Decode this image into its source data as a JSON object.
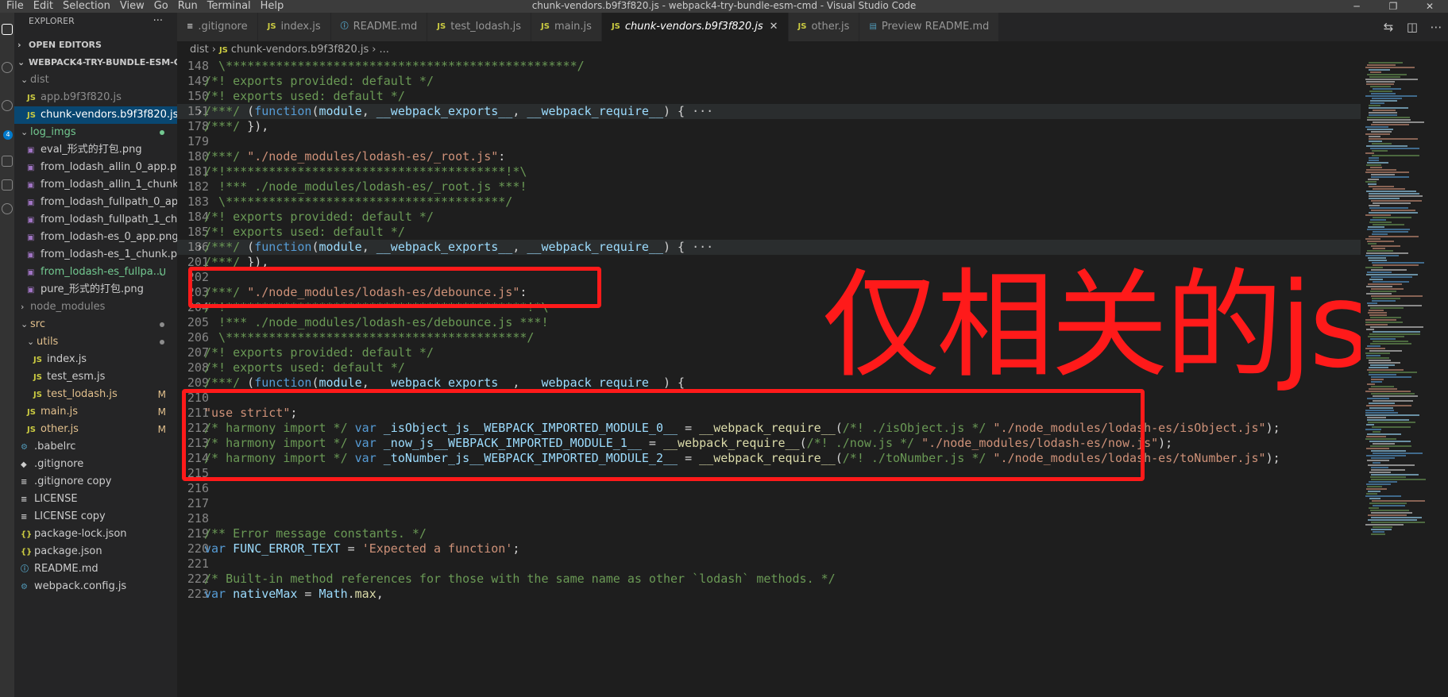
{
  "window": {
    "title": "chunk-vendors.b9f3f820.js - webpack4-try-bundle-esm-cmd - Visual Studio Code",
    "menus": [
      "File",
      "Edit",
      "Selection",
      "View",
      "Go",
      "Run",
      "Terminal",
      "Help"
    ]
  },
  "activity_bar": {
    "badge": "4"
  },
  "sidebar": {
    "title": "EXPLORER",
    "more": "···",
    "open_editors": "OPEN EDITORS",
    "project": "WEBPACK4-TRY-BUNDLE-ESM-C...",
    "items": [
      {
        "label": "dist",
        "type": "folder",
        "open": true,
        "indent": 1,
        "color": "#8c8c8c"
      },
      {
        "label": "app.b9f3f820.js",
        "type": "js",
        "indent": 2,
        "color": "#8c8c8c"
      },
      {
        "label": "chunk-vendors.b9f3f820.js",
        "type": "js",
        "indent": 2,
        "selected": true,
        "color": "#ffffff"
      },
      {
        "label": "log_imgs",
        "type": "folder",
        "open": true,
        "indent": 1,
        "color": "#73c991",
        "dot": "#73c991"
      },
      {
        "label": "eval_形式的打包.png",
        "type": "img",
        "indent": 2,
        "color": "#cccccc"
      },
      {
        "label": "from_lodash_allin_0_app.png",
        "type": "img",
        "indent": 2,
        "color": "#cccccc"
      },
      {
        "label": "from_lodash_allin_1_chunk....",
        "type": "img",
        "indent": 2,
        "color": "#cccccc"
      },
      {
        "label": "from_lodash_fullpath_0_ap...",
        "type": "img",
        "indent": 2,
        "color": "#cccccc"
      },
      {
        "label": "from_lodash_fullpath_1_ch...",
        "type": "img",
        "indent": 2,
        "color": "#cccccc"
      },
      {
        "label": "from_lodash-es_0_app.png",
        "type": "img",
        "indent": 2,
        "color": "#cccccc"
      },
      {
        "label": "from_lodash-es_1_chunk.p...",
        "type": "img",
        "indent": 2,
        "color": "#cccccc"
      },
      {
        "label": "from_lodash-es_fullpa...",
        "type": "img",
        "indent": 2,
        "color": "#73c991",
        "badge": "U"
      },
      {
        "label": "pure_形式的打包.png",
        "type": "img",
        "indent": 2,
        "color": "#cccccc"
      },
      {
        "label": "node_modules",
        "type": "folder",
        "open": false,
        "indent": 1,
        "color": "#8c8c8c"
      },
      {
        "label": "src",
        "type": "folder",
        "open": true,
        "indent": 1,
        "color": "#e2c08d",
        "dot": "#8c8c8c"
      },
      {
        "label": "utils",
        "type": "folder",
        "open": true,
        "indent": 2,
        "color": "#e2c08d",
        "dot": "#8c8c8c"
      },
      {
        "label": "index.js",
        "type": "js",
        "indent": 3,
        "color": "#cccccc"
      },
      {
        "label": "test_esm.js",
        "type": "js",
        "indent": 3,
        "color": "#cccccc"
      },
      {
        "label": "test_lodash.js",
        "type": "js",
        "indent": 3,
        "color": "#e2c08d",
        "badge": "M"
      },
      {
        "label": "main.js",
        "type": "js",
        "indent": 2,
        "color": "#e2c08d",
        "badge": "M"
      },
      {
        "label": "other.js",
        "type": "js",
        "indent": 2,
        "color": "#e2c08d",
        "badge": "M"
      },
      {
        "label": ".babelrc",
        "type": "cfg",
        "indent": 1,
        "color": "#cccccc"
      },
      {
        "label": ".gitignore",
        "type": "git",
        "indent": 1,
        "color": "#cccccc"
      },
      {
        "label": ".gitignore copy",
        "type": "txt",
        "indent": 1,
        "color": "#cccccc"
      },
      {
        "label": "LICENSE",
        "type": "txt",
        "indent": 1,
        "color": "#cccccc"
      },
      {
        "label": "LICENSE copy",
        "type": "txt",
        "indent": 1,
        "color": "#cccccc"
      },
      {
        "label": "package-lock.json",
        "type": "json",
        "indent": 1,
        "color": "#cccccc"
      },
      {
        "label": "package.json",
        "type": "json",
        "indent": 1,
        "color": "#cccccc"
      },
      {
        "label": "README.md",
        "type": "md",
        "indent": 1,
        "color": "#cccccc"
      },
      {
        "label": "webpack.config.js",
        "type": "cfg",
        "indent": 1,
        "color": "#cccccc"
      }
    ]
  },
  "tabs": [
    {
      "label": ".gitignore",
      "icon": "≡",
      "type": "git"
    },
    {
      "label": "index.js",
      "icon": "JS",
      "type": "js"
    },
    {
      "label": "README.md",
      "icon": "ⓘ",
      "type": "md"
    },
    {
      "label": "test_lodash.js",
      "icon": "JS",
      "type": "js"
    },
    {
      "label": "main.js",
      "icon": "JS",
      "type": "js"
    },
    {
      "label": "chunk-vendors.b9f3f820.js",
      "icon": "JS",
      "type": "js",
      "active": true
    },
    {
      "label": "other.js",
      "icon": "JS",
      "type": "js"
    },
    {
      "label": "Preview README.md",
      "icon": "▤",
      "type": "md"
    }
  ],
  "breadcrumb": {
    "dir": "dist",
    "file": "chunk-vendors.b9f3f820.js",
    "more": "..."
  },
  "code_lines": [
    {
      "n": "148",
      "t": [
        [
          "c-com",
          "  \\*************************************************/"
        ]
      ]
    },
    {
      "n": "149",
      "t": [
        [
          "c-com",
          "/*! exports provided: default */"
        ]
      ]
    },
    {
      "n": "150",
      "t": [
        [
          "c-com",
          "/*! exports used: default */"
        ]
      ]
    },
    {
      "n": "151",
      "fold": true,
      "hl": true,
      "t": [
        [
          "c-com",
          "/***/"
        ],
        [
          "c-txt",
          " ("
        ],
        [
          "c-kw",
          "function"
        ],
        [
          "c-txt",
          "("
        ],
        [
          "c-var",
          "module"
        ],
        [
          "c-txt",
          ", "
        ],
        [
          "c-var",
          "__webpack_exports__"
        ],
        [
          "c-txt",
          ", "
        ],
        [
          "c-var",
          "__webpack_require__"
        ],
        [
          "c-txt",
          ") { "
        ],
        [
          "c-ell",
          "···"
        ]
      ]
    },
    {
      "n": "178",
      "t": [
        [
          "c-com",
          "/***/"
        ],
        [
          "c-txt",
          " }),"
        ]
      ]
    },
    {
      "n": "179",
      "t": []
    },
    {
      "n": "180",
      "t": [
        [
          "c-com",
          "/***/"
        ],
        [
          "c-txt",
          " "
        ],
        [
          "c-str",
          "\"./node_modules/lodash-es/_root.js\""
        ],
        [
          "c-txt",
          ":"
        ]
      ]
    },
    {
      "n": "181",
      "t": [
        [
          "c-com",
          "/*!***************************************!*\\"
        ]
      ]
    },
    {
      "n": "182",
      "t": [
        [
          "c-com",
          "  !*** ./node_modules/lodash-es/_root.js ***!"
        ]
      ]
    },
    {
      "n": "183",
      "t": [
        [
          "c-com",
          "  \\***************************************/"
        ]
      ]
    },
    {
      "n": "184",
      "t": [
        [
          "c-com",
          "/*! exports provided: default */"
        ]
      ]
    },
    {
      "n": "185",
      "t": [
        [
          "c-com",
          "/*! exports used: default */"
        ]
      ]
    },
    {
      "n": "186",
      "fold": true,
      "hl": true,
      "t": [
        [
          "c-com",
          "/***/"
        ],
        [
          "c-txt",
          " ("
        ],
        [
          "c-kw",
          "function"
        ],
        [
          "c-txt",
          "("
        ],
        [
          "c-var",
          "module"
        ],
        [
          "c-txt",
          ", "
        ],
        [
          "c-var",
          "__webpack_exports__"
        ],
        [
          "c-txt",
          ", "
        ],
        [
          "c-var",
          "__webpack_require__"
        ],
        [
          "c-txt",
          ") { "
        ],
        [
          "c-ell",
          "···"
        ]
      ]
    },
    {
      "n": "201",
      "t": [
        [
          "c-com",
          "/***/"
        ],
        [
          "c-txt",
          " }),"
        ]
      ]
    },
    {
      "n": "202",
      "t": []
    },
    {
      "n": "203",
      "t": [
        [
          "c-com",
          "/***/"
        ],
        [
          "c-txt",
          " "
        ],
        [
          "c-str",
          "\"./node_modules/lodash-es/debounce.js\""
        ],
        [
          "c-txt",
          ":"
        ]
      ]
    },
    {
      "n": "204",
      "t": [
        [
          "c-com",
          "/*!******************************************!*\\"
        ]
      ]
    },
    {
      "n": "205",
      "t": [
        [
          "c-com",
          "  !*** ./node_modules/lodash-es/debounce.js ***!"
        ]
      ]
    },
    {
      "n": "206",
      "t": [
        [
          "c-com",
          "  \\******************************************/"
        ]
      ]
    },
    {
      "n": "207",
      "t": [
        [
          "c-com",
          "/*! exports provided: default */"
        ]
      ]
    },
    {
      "n": "208",
      "t": [
        [
          "c-com",
          "/*! exports used: default */"
        ]
      ]
    },
    {
      "n": "209",
      "t": [
        [
          "c-com",
          "/***/"
        ],
        [
          "c-txt",
          " ("
        ],
        [
          "c-kw",
          "function"
        ],
        [
          "c-txt",
          "("
        ],
        [
          "c-var",
          "module"
        ],
        [
          "c-txt",
          ", "
        ],
        [
          "c-var",
          "__webpack_exports__"
        ],
        [
          "c-txt",
          ", "
        ],
        [
          "c-var",
          "__webpack_require__"
        ],
        [
          "c-txt",
          ") {"
        ]
      ]
    },
    {
      "n": "210",
      "t": []
    },
    {
      "n": "211",
      "t": [
        [
          "c-str",
          "\"use strict\""
        ],
        [
          "c-txt",
          ";"
        ]
      ]
    },
    {
      "n": "212",
      "t": [
        [
          "c-com",
          "/* harmony import */"
        ],
        [
          "c-txt",
          " "
        ],
        [
          "c-kw",
          "var"
        ],
        [
          "c-txt",
          " "
        ],
        [
          "c-var",
          "_isObject_js__WEBPACK_IMPORTED_MODULE_0__"
        ],
        [
          "c-txt",
          " = "
        ],
        [
          "c-fn",
          "__webpack_require__"
        ],
        [
          "c-txt",
          "("
        ],
        [
          "c-com",
          "/*! ./isObject.js */"
        ],
        [
          "c-txt",
          " "
        ],
        [
          "c-str",
          "\"./node_modules/lodash-es/isObject.js\""
        ],
        [
          "c-txt",
          ");"
        ]
      ]
    },
    {
      "n": "213",
      "t": [
        [
          "c-com",
          "/* harmony import */"
        ],
        [
          "c-txt",
          " "
        ],
        [
          "c-kw",
          "var"
        ],
        [
          "c-txt",
          " "
        ],
        [
          "c-var",
          "_now_js__WEBPACK_IMPORTED_MODULE_1__"
        ],
        [
          "c-txt",
          " = "
        ],
        [
          "c-fn",
          "__webpack_require__"
        ],
        [
          "c-txt",
          "("
        ],
        [
          "c-com",
          "/*! ./now.js */"
        ],
        [
          "c-txt",
          " "
        ],
        [
          "c-str",
          "\"./node_modules/lodash-es/now.js\""
        ],
        [
          "c-txt",
          ");"
        ]
      ]
    },
    {
      "n": "214",
      "t": [
        [
          "c-com",
          "/* harmony import */"
        ],
        [
          "c-txt",
          " "
        ],
        [
          "c-kw",
          "var"
        ],
        [
          "c-txt",
          " "
        ],
        [
          "c-var",
          "_toNumber_js__WEBPACK_IMPORTED_MODULE_2__"
        ],
        [
          "c-txt",
          " = "
        ],
        [
          "c-fn",
          "__webpack_require__"
        ],
        [
          "c-txt",
          "("
        ],
        [
          "c-com",
          "/*! ./toNumber.js */"
        ],
        [
          "c-txt",
          " "
        ],
        [
          "c-str",
          "\"./node_modules/lodash-es/toNumber.js\""
        ],
        [
          "c-txt",
          ");"
        ]
      ]
    },
    {
      "n": "215",
      "t": []
    },
    {
      "n": "216",
      "t": []
    },
    {
      "n": "217",
      "t": []
    },
    {
      "n": "218",
      "t": []
    },
    {
      "n": "219",
      "t": [
        [
          "c-com",
          "/** Error message constants. */"
        ]
      ]
    },
    {
      "n": "220",
      "t": [
        [
          "c-kw",
          "var"
        ],
        [
          "c-txt",
          " "
        ],
        [
          "c-var",
          "FUNC_ERROR_TEXT"
        ],
        [
          "c-txt",
          " = "
        ],
        [
          "c-str",
          "'Expected a function'"
        ],
        [
          "c-txt",
          ";"
        ]
      ]
    },
    {
      "n": "221",
      "t": []
    },
    {
      "n": "222",
      "t": [
        [
          "c-com",
          "/* Built-in method references for those with the same name as other `lodash` methods. */"
        ]
      ]
    },
    {
      "n": "223",
      "t": [
        [
          "c-kw",
          "var"
        ],
        [
          "c-txt",
          " "
        ],
        [
          "c-var",
          "nativeMax"
        ],
        [
          "c-txt",
          " = "
        ],
        [
          "c-var",
          "Math"
        ],
        [
          "c-txt",
          "."
        ],
        [
          "c-fn",
          "max"
        ],
        [
          "c-txt",
          ","
        ]
      ]
    }
  ],
  "annotation": {
    "text": "仅相关的js",
    "color": "#ff1a1a"
  }
}
